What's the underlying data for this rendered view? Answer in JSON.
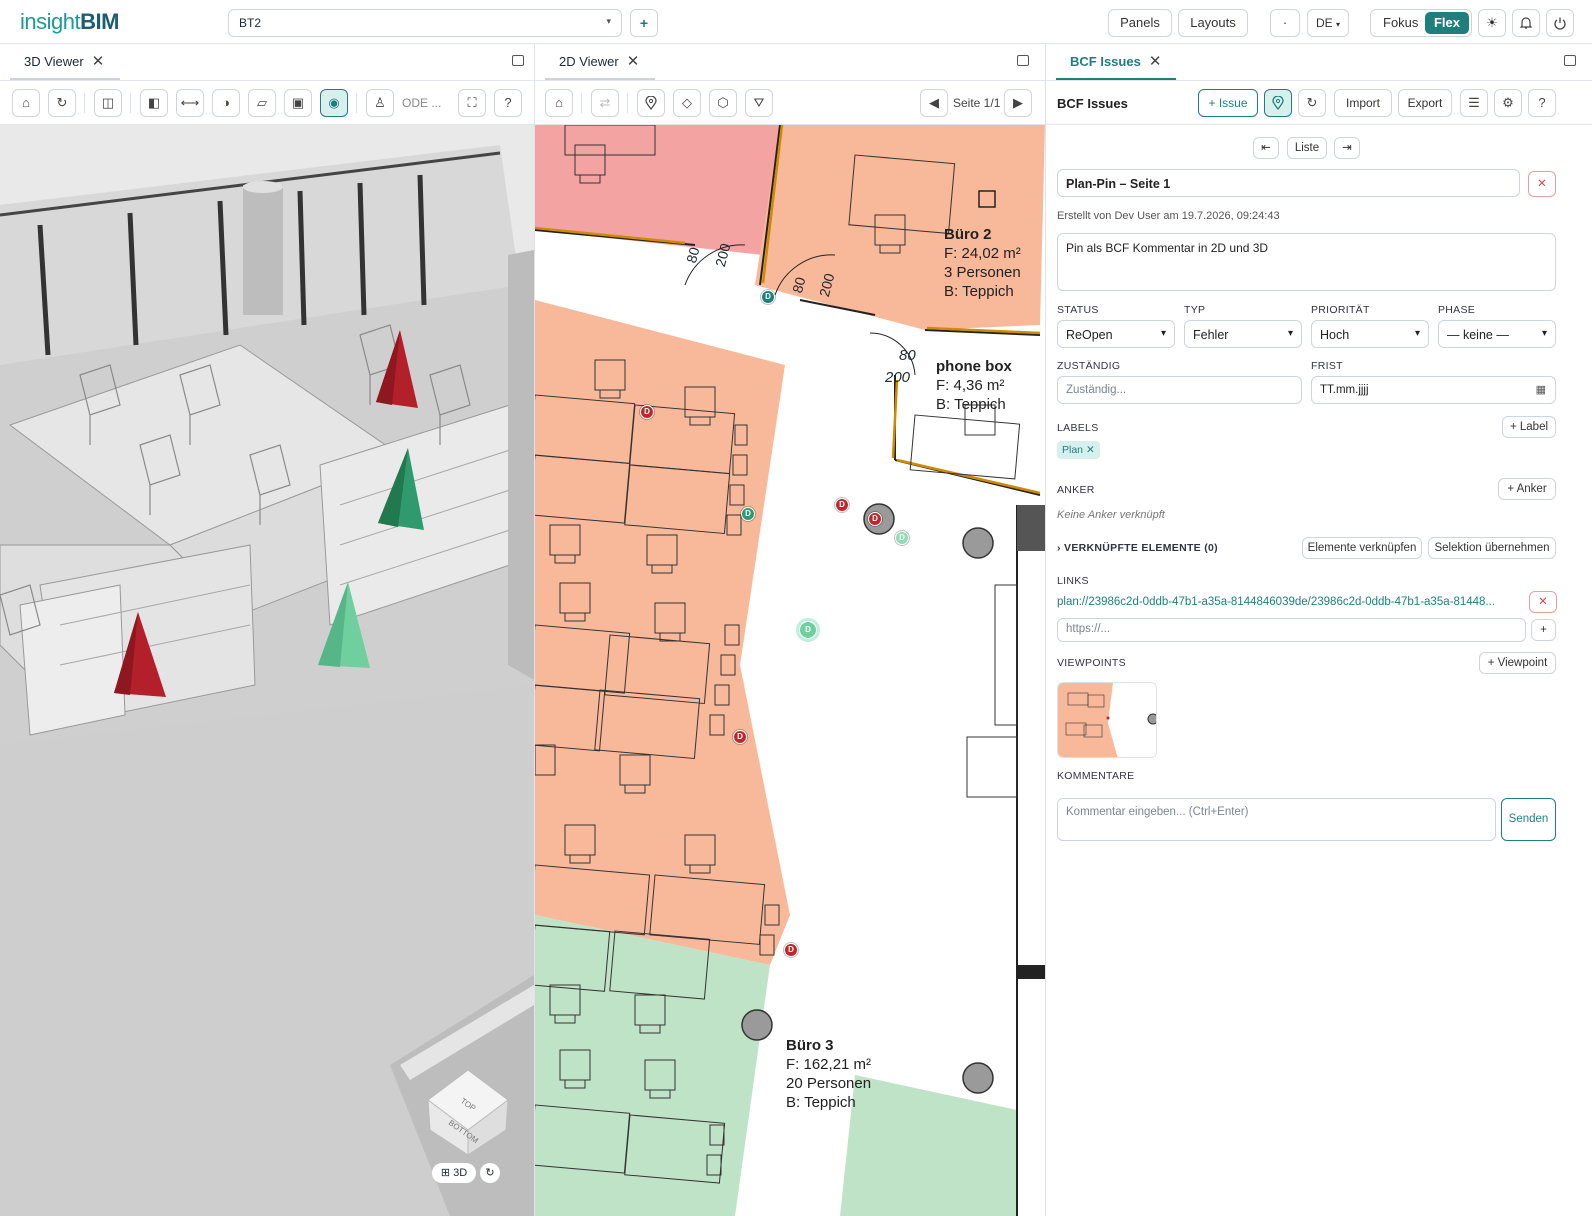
{
  "header": {
    "logo_part1": "insight",
    "logo_part2": "BIM",
    "project_value": "BT2",
    "add_label": "+",
    "panels_label": "Panels",
    "layouts_label": "Layouts",
    "dot_label": "·",
    "lang_label": "DE",
    "fokus_label": "Fokus",
    "flex_label": "Flex"
  },
  "viewer3d": {
    "tab_label": "3D Viewer",
    "mode_text": "ODE ...",
    "cube_top": "TOP",
    "cube_bottom": "BOTTOM",
    "mode_button": "3D",
    "colors": {
      "bg": "#cdcdcd",
      "pin_red": "#b3202a",
      "pin_green": "#2f9a6e",
      "pin_mint": "#6fcf9f"
    }
  },
  "viewer2d": {
    "tab_label": "2D Viewer",
    "page_label": "Seite 1/1",
    "rooms": {
      "buero2": {
        "name": "Büro 2",
        "area": "F: 24,02 m²",
        "persons": "3 Personen",
        "floor": "B: Teppich"
      },
      "phonebox": {
        "name": "phone box",
        "area": "F: 4,36 m²",
        "floor": "B: Teppich"
      },
      "buero3": {
        "name": "Büro 3",
        "area": "F: 162,21 m²",
        "persons": "20 Personen",
        "floor": "B: Teppich"
      }
    },
    "door_labels": [
      "80",
      "200",
      "80",
      "200",
      "80",
      "200"
    ],
    "pin_letter": "D",
    "colors": {
      "room_red": "#f4a3a3",
      "room_orange": "#f8b89a",
      "room_green": "#bfe3c6"
    }
  },
  "bcf": {
    "tab_label": "BCF Issues",
    "title": "BCF Issues",
    "issue_btn": "+ Issue",
    "import_btn": "Import",
    "export_btn": "Export",
    "list_btn": "Liste",
    "issue_title": "Plan-Pin – Seite 1",
    "meta": "Erstellt von Dev User am 19.7.2026, 09:24:43",
    "description": "Pin als BCF Kommentar in 2D und 3D",
    "status_label": "STATUS",
    "status_value": "ReOpen",
    "typ_label": "TYP",
    "typ_value": "Fehler",
    "prio_label": "PRIORITÄT",
    "prio_value": "Hoch",
    "phase_label": "PHASE",
    "phase_value": "— keine —",
    "assign_label": "ZUSTÄNDIG",
    "assign_placeholder": "Zuständig...",
    "due_label": "FRIST",
    "due_placeholder": "TT.mm.jjjj",
    "labels_label": "LABELS",
    "add_label_btn": "+ Label",
    "label_chip": "Plan",
    "anker_label": "ANKER",
    "add_anker_btn": "+ Anker",
    "anker_empty": "Keine Anker verknüpft",
    "linked_label": "VERKNÜPFTE ELEMENTE (0)",
    "link_elements_btn": "Elemente verknüpfen",
    "take_selection_btn": "Selektion übernehmen",
    "links_label": "LINKS",
    "link_value": "plan://23986c2d-0ddb-47b1-a35a-8144846039de/23986c2d-0ddb-47b1-a35a-81448...",
    "link_placeholder": "https://...",
    "viewpoints_label": "VIEWPOINTS",
    "add_viewpoint_btn": "+ Viewpoint",
    "comments_label": "KOMMENTARE",
    "comment_placeholder": "Kommentar eingeben... (Ctrl+Enter)",
    "send_btn": "Senden",
    "accent": "#1f7f7c"
  }
}
